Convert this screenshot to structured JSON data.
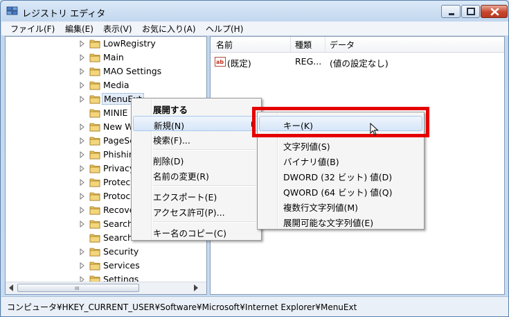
{
  "window": {
    "title": "レジストリ エディタ",
    "icon": "regedit-icon"
  },
  "menubar": {
    "items": [
      "ファイル(F)",
      "編集(E)",
      "表示(V)",
      "お気に入り(A)",
      "ヘルプ(H)"
    ]
  },
  "tree": {
    "items": [
      {
        "label": "LowRegistry",
        "expandable": true
      },
      {
        "label": "Main",
        "expandable": true
      },
      {
        "label": "MAO Settings",
        "expandable": true
      },
      {
        "label": "Media",
        "expandable": true
      },
      {
        "label": "MenuExt",
        "expandable": true,
        "selected": true
      },
      {
        "label": "MINIE",
        "expandable": false
      },
      {
        "label": "New W",
        "expandable": true
      },
      {
        "label": "PageSe",
        "expandable": true
      },
      {
        "label": "Phishin",
        "expandable": true
      },
      {
        "label": "Privacy",
        "expandable": true
      },
      {
        "label": "Protec",
        "expandable": true
      },
      {
        "label": "Protoc",
        "expandable": true
      },
      {
        "label": "Recove",
        "expandable": true
      },
      {
        "label": "Search",
        "expandable": true
      },
      {
        "label": "Search",
        "expandable": false
      },
      {
        "label": "Security",
        "expandable": true
      },
      {
        "label": "Services",
        "expandable": true
      },
      {
        "label": "Settings",
        "expandable": true
      }
    ]
  },
  "list": {
    "columns": [
      "名前",
      "種類",
      "データ"
    ],
    "rows": [
      {
        "name": "(既定)",
        "type": "REG...",
        "data": "(値の設定なし)"
      }
    ]
  },
  "context_menu": {
    "items": [
      {
        "label": "展開する",
        "bold": true
      },
      {
        "label": "新規(N)",
        "submenu": true,
        "highlight": true
      },
      {
        "label": "検索(F)..."
      },
      {
        "label": "削除(D)"
      },
      {
        "label": "名前の変更(R)"
      },
      {
        "label": "エクスポート(E)"
      },
      {
        "label": "アクセス許可(P)..."
      },
      {
        "label": "キー名のコピー(C)"
      }
    ]
  },
  "submenu": {
    "items": [
      {
        "label": "キー(K)",
        "highlight": true
      },
      {
        "label": "文字列値(S)"
      },
      {
        "label": "バイナリ値(B)"
      },
      {
        "label": "DWORD (32 ビット) 値(D)"
      },
      {
        "label": "QWORD (64 ビット) 値(Q)"
      },
      {
        "label": "複数行文字列値(M)"
      },
      {
        "label": "展開可能な文字列値(E)"
      }
    ]
  },
  "scrollbar": {
    "grip": "III"
  },
  "statusbar": {
    "path": "コンピュータ¥HKEY_CURRENT_USER¥Software¥Microsoft¥Internet Explorer¥MenuExt"
  },
  "colors": {
    "highlight_box": "#e50000",
    "folder": "#e8c25a"
  }
}
